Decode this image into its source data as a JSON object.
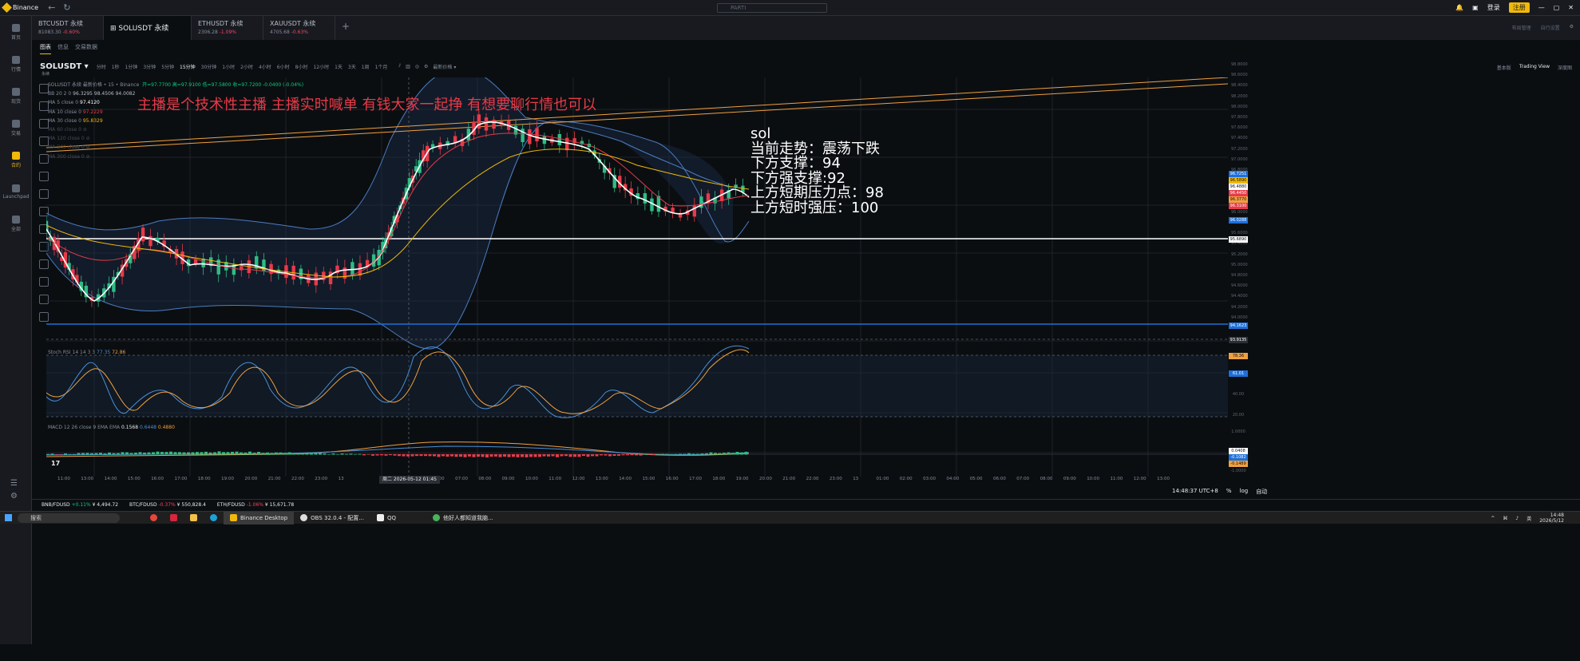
{
  "window": {
    "brand": "Binance",
    "search_placeholder": "PARTI",
    "login": "登录",
    "register": "注册"
  },
  "sidebar": {
    "items": [
      {
        "label": "首页",
        "icon": "home-icon"
      },
      {
        "label": "行情",
        "icon": "chart-bars-icon"
      },
      {
        "label": "现货",
        "icon": "coins-icon"
      },
      {
        "label": "交易",
        "icon": "swap-icon"
      },
      {
        "label": "合约",
        "icon": "futures-icon"
      },
      {
        "label": "Launchpad",
        "icon": "rocket-icon"
      },
      {
        "label": "全部",
        "icon": "grid-icon"
      }
    ]
  },
  "tabs": [
    {
      "name": "BTCUSDT 永续",
      "price": "81083.30",
      "change": "-0.60%",
      "dir": "neg"
    },
    {
      "name": "SOLUSDT 永续",
      "price": "",
      "change": "",
      "dir": "",
      "active": true
    },
    {
      "name": "ETHUSDT 永续",
      "price": "2306.28",
      "change": "-1.09%",
      "dir": "neg"
    },
    {
      "name": "XAUUSDT 永续",
      "price": "4705.68",
      "change": "-0.63%",
      "dir": "neg"
    }
  ],
  "tabs_right": [
    "布局管理",
    "自行设置"
  ],
  "subtabs": [
    "图表",
    "信息",
    "交易数据"
  ],
  "symbol": {
    "name": "SOLUSDT",
    "sub": "永续",
    "timeframes": [
      "分时",
      "1秒",
      "1分钟",
      "3分钟",
      "5分钟",
      "15分钟",
      "30分钟",
      "1小时",
      "2小时",
      "4小时",
      "6小时",
      "8小时",
      "12小时",
      "1天",
      "3天",
      "1周",
      "1个月"
    ],
    "active_tf": "15分钟",
    "latest_price_label": "最新价格",
    "views": [
      "基本版",
      "Trading View",
      "深度图"
    ]
  },
  "legend": {
    "title": "SOLUSDT 永续 最新价格 • 15 • Binance",
    "ohlc": "开=97.7700 高=97.9100 低=97.5800 收=97.7200 -0.0400 (-0.04%)",
    "lines": [
      {
        "label": "BB 20 2 0",
        "value": "96.3295  98.4506  94.0082"
      },
      {
        "label": "MA 5 close 0",
        "value": "97.4120"
      },
      {
        "label": "MA 10 close 0",
        "value": "97.2229"
      },
      {
        "label": "MA 30 close 0",
        "value": "95.8329"
      },
      {
        "label": "MA 60 close 0",
        "value": ""
      },
      {
        "label": "MA 120 close 0",
        "value": ""
      },
      {
        "label": "MA 240 close 0",
        "value": ""
      },
      {
        "label": "MA 300 close 0",
        "value": ""
      }
    ]
  },
  "overlay_text": "主播是个技术性主播 主播实时喊单 有钱大家一起挣 有想要聊行情也可以",
  "notes": [
    "sol",
    "当前走势：震荡下跌",
    "下方支撑：94",
    "下方强支撑:92",
    "上方短期压力点：98",
    "上方短时强压：100"
  ],
  "price_axis": [
    "98.8000",
    "98.6000",
    "98.4000",
    "98.2000",
    "98.0000",
    "97.8000",
    "97.6000",
    "97.4000",
    "97.2000",
    "97.0000",
    "96.8000",
    "96.6000",
    "96.4000",
    "96.2000",
    "96.0000",
    "95.8000",
    "95.6000",
    "95.4000",
    "95.2000",
    "95.0000",
    "94.8000",
    "94.6000",
    "94.4000",
    "94.2000",
    "94.0000"
  ],
  "price_labels": [
    {
      "value": "96.7251",
      "color": "#1e6fd9"
    },
    {
      "value": "96.5890",
      "color": "#f0b90b"
    },
    {
      "value": "96.4880",
      "color": "#ffffff"
    },
    {
      "value": "96.4450",
      "color": "#e83a48"
    },
    {
      "value": "96.3770",
      "color": "#f0a040"
    },
    {
      "value": "96.3100",
      "color": "#e83a48"
    },
    {
      "value": "96.0288",
      "color": "#1e6fd9"
    },
    {
      "value": "95.6890",
      "color": "#ffffff"
    },
    {
      "value": "94.1623",
      "color": "#1e6fd9"
    },
    {
      "value": "93.9135",
      "color": "#2b2f36"
    }
  ],
  "stoch": {
    "label": "Stoch RSI 14 14 3 3",
    "k": "77.35",
    "d": "72.86",
    "axis": [
      "80.00",
      "60.00",
      "40.00",
      "20.00"
    ],
    "labels": [
      "78.36",
      "61.01"
    ]
  },
  "macd": {
    "label": "MACD 12 26 close 9 EMA EMA",
    "v1": "0.1568",
    "v2": "0.6448",
    "v3": "0.4880",
    "axis": [
      "1.0000",
      "0.0000",
      "-1.0000"
    ],
    "labels": [
      "0.0408",
      "-0.1082",
      "-0.1489"
    ]
  },
  "time_axis": [
    "11:00",
    "13:00",
    "14:00",
    "15:00",
    "16:00",
    "17:00",
    "18:00",
    "19:00",
    "20:00",
    "21:00",
    "22:00",
    "23:00",
    "13",
    "",
    "04:00",
    "05:00",
    "06:00",
    "07:00",
    "08:00",
    "09:00",
    "10:00",
    "11:00",
    "12:00",
    "13:00",
    "14:00",
    "15:00",
    "16:00",
    "17:00",
    "18:00",
    "19:00",
    "20:00",
    "21:00",
    "22:00",
    "23:00",
    "13",
    "01:00",
    "02:00",
    "03:00",
    "04:00",
    "05:00",
    "06:00",
    "07:00",
    "08:00",
    "09:00",
    "10:00",
    "11:00",
    "12:00",
    "13:00"
  ],
  "crosshair_time": "周二 2026-05-12   01:45",
  "clock_utc": "14:48:37 UTC+8",
  "log_label": "log",
  "auto_label": "自动",
  "status": [
    {
      "sym": "BNB/FDUSD",
      "chg": "+0.11%",
      "price": "¥ 4,494.72",
      "dir": "pos"
    },
    {
      "sym": "BTC/FDUSD",
      "chg": "-0.37%",
      "price": "¥ 550,828.4",
      "dir": "neg"
    },
    {
      "sym": "ETH/FDUSD",
      "chg": "-1.06%",
      "price": "¥ 15,671.78",
      "dir": "neg"
    }
  ],
  "taskbar": {
    "search": "搜索",
    "apps": [
      "Binance Desktop",
      "OBS 32.0.4 - 配置...",
      "QQ",
      "他好人都知道我脑..."
    ],
    "lang": "英",
    "time": "14:48",
    "date": "2026/5/12"
  }
}
